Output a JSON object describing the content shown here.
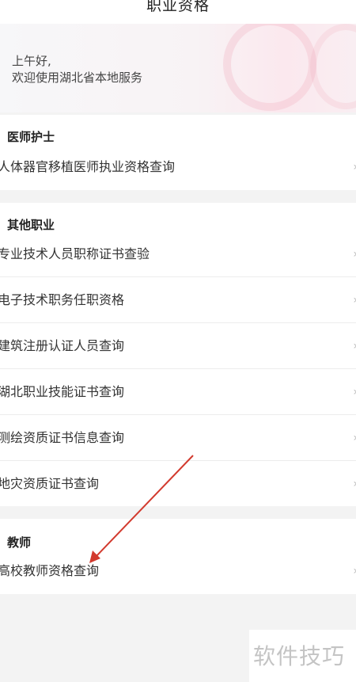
{
  "header": {
    "title": "职业资格"
  },
  "greeting": {
    "line1": "上午好,",
    "line2": "欢迎使用湖北省本地服务"
  },
  "sections": [
    {
      "title": "医师护士",
      "items": [
        {
          "label": "人体器官移植医师执业资格查询"
        }
      ]
    },
    {
      "title": "其他职业",
      "items": [
        {
          "label": "专业技术人员职称证书查验"
        },
        {
          "label": "电子技术职务任职资格"
        },
        {
          "label": "建筑注册认证人员查询"
        },
        {
          "label": "湖北职业技能证书查询"
        },
        {
          "label": "测绘资质证书信息查询"
        },
        {
          "label": "地灾资质证书查询"
        }
      ]
    },
    {
      "title": "教师",
      "items": [
        {
          "label": "高校教师资格查询"
        }
      ]
    }
  ],
  "watermark": {
    "text": "软件技巧"
  },
  "colors": {
    "annotation_arrow": "#d23a2e",
    "page_background": "#f3f3f3"
  },
  "icons": {
    "row_chevron": "chevron-right-icon"
  }
}
